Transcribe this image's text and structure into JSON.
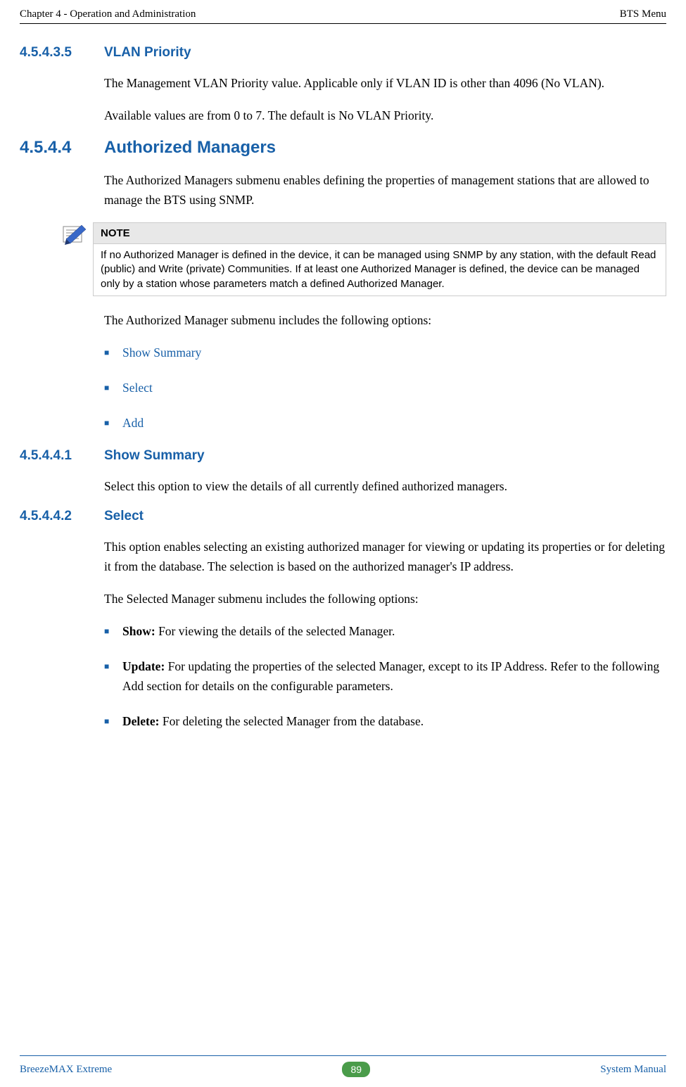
{
  "header": {
    "left": "Chapter 4 - Operation and Administration",
    "right": "BTS Menu"
  },
  "sections": {
    "s1": {
      "num": "4.5.4.3.5",
      "title": "VLAN Priority"
    },
    "s2": {
      "num": "4.5.4.4",
      "title": "Authorized Managers"
    },
    "s3": {
      "num": "4.5.4.4.1",
      "title": "Show Summary"
    },
    "s4": {
      "num": "4.5.4.4.2",
      "title": "Select"
    }
  },
  "para": {
    "p1": "The Management VLAN Priority value. Applicable only if VLAN ID is other than 4096 (No VLAN).",
    "p2": "Available values are from 0 to 7. The default is No VLAN Priority.",
    "p3": "The Authorized Managers submenu enables defining the properties of management stations that are allowed to manage the BTS using SNMP.",
    "p4": "The Authorized Manager submenu includes the following options:",
    "p5": "Select this option to view the details of all currently defined authorized managers.",
    "p6": "This option enables selecting an existing authorized manager for viewing or updating its properties or for deleting it from the database. The selection is based on the authorized manager's IP address.",
    "p7": "The Selected Manager submenu includes the following options:"
  },
  "note": {
    "label": "NOTE",
    "body": "If no Authorized Manager is defined in the device, it can be managed using SNMP by any station, with the default Read (public) and Write (private) Communities. If at least one Authorized Manager is defined, the device can be managed only by a station whose parameters match a defined Authorized Manager."
  },
  "links": {
    "l1": "Show Summary",
    "l2": "Select",
    "l3": "Add"
  },
  "options": {
    "o1a": "Show:",
    "o1b": " For viewing the details of the selected Manager.",
    "o2a": "Update:",
    "o2b": " For updating the properties of the selected Manager, except to its IP Address. Refer to the following Add section for details on the configurable parameters.",
    "o3a": "Delete:",
    "o3b": " For deleting the selected Manager from the database."
  },
  "footer": {
    "left": "BreezeMAX Extreme",
    "page": "89",
    "right": "System Manual"
  }
}
